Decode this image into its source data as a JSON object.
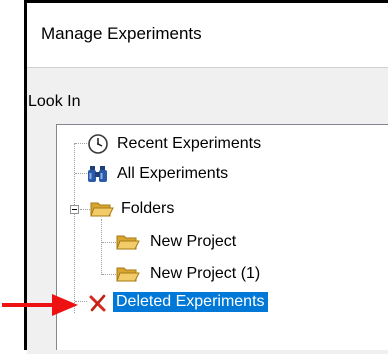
{
  "dialog": {
    "title": "Manage Experiments",
    "look_in_label": "Look In"
  },
  "tree": {
    "items": [
      {
        "label": "Recent Experiments",
        "icon": "clock-icon",
        "level": 0
      },
      {
        "label": "All Experiments",
        "icon": "binoculars-icon",
        "level": 0
      },
      {
        "label": "Folders",
        "icon": "folder-open-icon",
        "level": 0,
        "expanded": true
      },
      {
        "label": "New Project",
        "icon": "folder-open-icon",
        "level": 1
      },
      {
        "label": "New Project (1)",
        "icon": "folder-open-icon",
        "level": 1
      },
      {
        "label": "Deleted Experiments",
        "icon": "delete-x-icon",
        "level": 0,
        "selected": true
      }
    ]
  },
  "colors": {
    "selection": "#0078d7",
    "annotation_arrow": "#ee1111",
    "delete_x": "#d42a1e",
    "folder": "#e8b94a"
  }
}
